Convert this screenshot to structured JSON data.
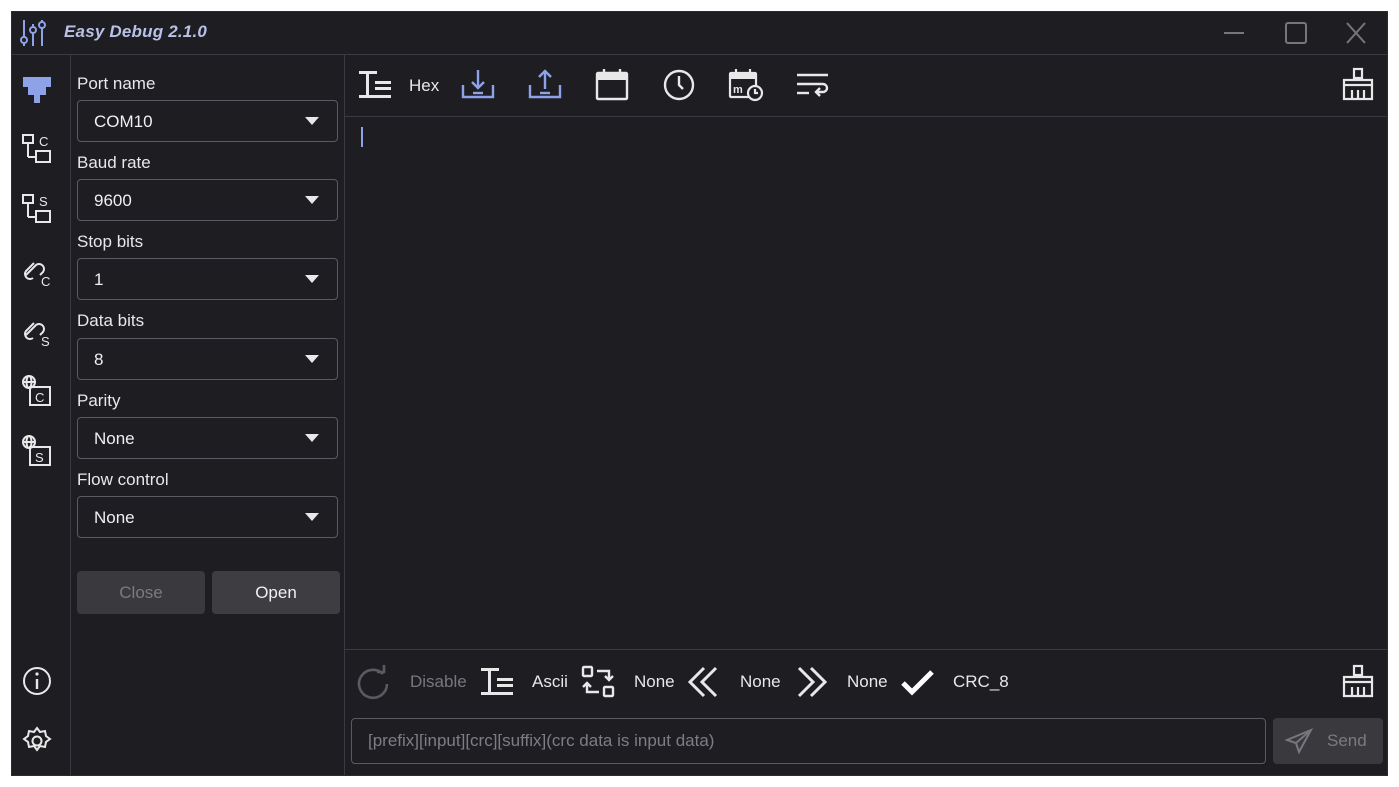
{
  "window": {
    "title": "Easy Debug 2.1.0"
  },
  "panel": {
    "fields": [
      {
        "label": "Port name",
        "value": "COM10"
      },
      {
        "label": "Baud rate",
        "value": "9600"
      },
      {
        "label": "Stop bits",
        "value": "1"
      },
      {
        "label": "Data bits",
        "value": "8"
      },
      {
        "label": "Parity",
        "value": "None"
      },
      {
        "label": "Flow control",
        "value": "None"
      }
    ],
    "close_label": "Close",
    "open_label": "Open"
  },
  "top_toolbar": {
    "hex_label": "Hex"
  },
  "bottom_toolbar": {
    "cycle_label": "Disable",
    "format_label": "Ascii",
    "esc_label": "None",
    "prefix_label": "None",
    "suffix_label": "None",
    "crc_label": "CRC_8"
  },
  "send": {
    "placeholder": "[prefix][input][crc][suffix](crc data is input data)",
    "button_label": "Send"
  },
  "colors": {
    "background": "#1d1d22",
    "accent": "#8ea2e8",
    "text": "#e8e8e8",
    "border": "#5a5a62"
  }
}
